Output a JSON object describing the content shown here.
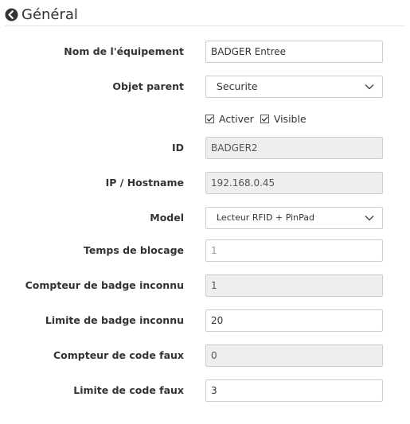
{
  "header": {
    "title": "Général",
    "icon": "arrow-circle-left-icon"
  },
  "form": {
    "name": {
      "label": "Nom de l'équipement",
      "value": "BADGER Entree"
    },
    "parent": {
      "label": "Objet parent",
      "value": "Securite"
    },
    "enable": {
      "label": "Activer",
      "checked": true
    },
    "visible": {
      "label": "Visible",
      "checked": true
    },
    "id": {
      "label": "ID",
      "value": "BADGER2"
    },
    "ip": {
      "label": "IP / Hostname",
      "value": "192.168.0.45"
    },
    "model": {
      "label": "Model",
      "value": "Lecteur RFID + PinPad"
    },
    "block_time": {
      "label": "Temps de blocage",
      "value": "1"
    },
    "unknown_badge_counter": {
      "label": "Compteur de badge inconnu",
      "value": "1"
    },
    "unknown_badge_limit": {
      "label": "Limite de badge inconnu",
      "value": "20"
    },
    "wrong_code_counter": {
      "label": "Compteur de code faux",
      "value": "0"
    },
    "wrong_code_limit": {
      "label": "Limite de code faux",
      "value": "3"
    }
  }
}
